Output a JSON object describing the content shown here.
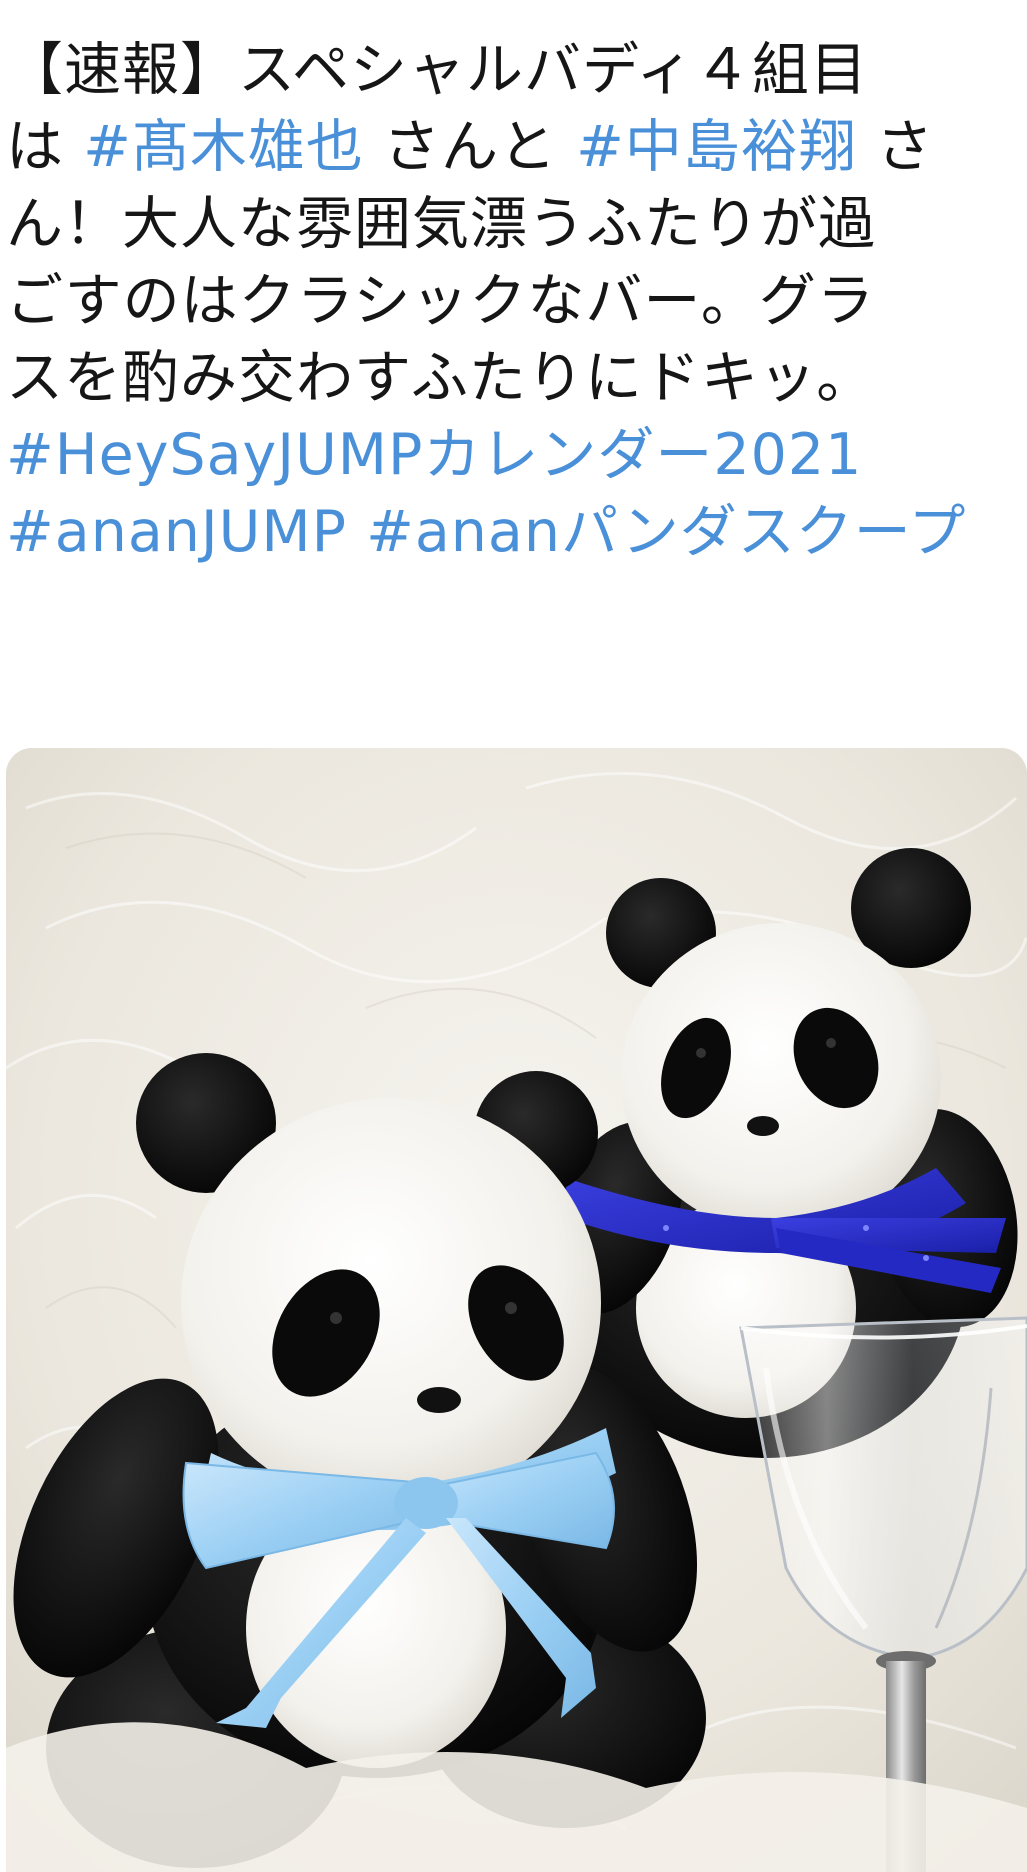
{
  "tweet": {
    "text_lines": [
      [
        {
          "type": "text",
          "value": "【速報】スペシャルバディ４組目"
        }
      ],
      [
        {
          "type": "text",
          "value": "は "
        },
        {
          "type": "hashtag",
          "value": "#髙木雄也"
        },
        {
          "type": "text",
          "value": " さんと "
        },
        {
          "type": "hashtag",
          "value": "#中島裕翔"
        },
        {
          "type": "text",
          "value": " さ"
        }
      ],
      [
        {
          "type": "text",
          "value": "ん！大人な雰囲気漂うふたりが過"
        }
      ],
      [
        {
          "type": "text",
          "value": "ごすのはクラシックなバー。グラ"
        }
      ],
      [
        {
          "type": "text",
          "value": "スを酌み交わすふたりにドキッ。"
        }
      ],
      [
        {
          "type": "hashtag",
          "value": "#HeySayJUMPカレンダー2021"
        }
      ],
      [
        {
          "type": "hashtag",
          "value": "#ananJUMP"
        },
        {
          "type": "text",
          "value": " "
        },
        {
          "type": "hashtag",
          "value": "#ananパンダスクープ"
        }
      ]
    ],
    "colors": {
      "text": "#161616",
      "hashtag": "#4a90d9",
      "background": "#ffffff"
    },
    "media": {
      "icon": "photo",
      "alt": ""
    }
  }
}
